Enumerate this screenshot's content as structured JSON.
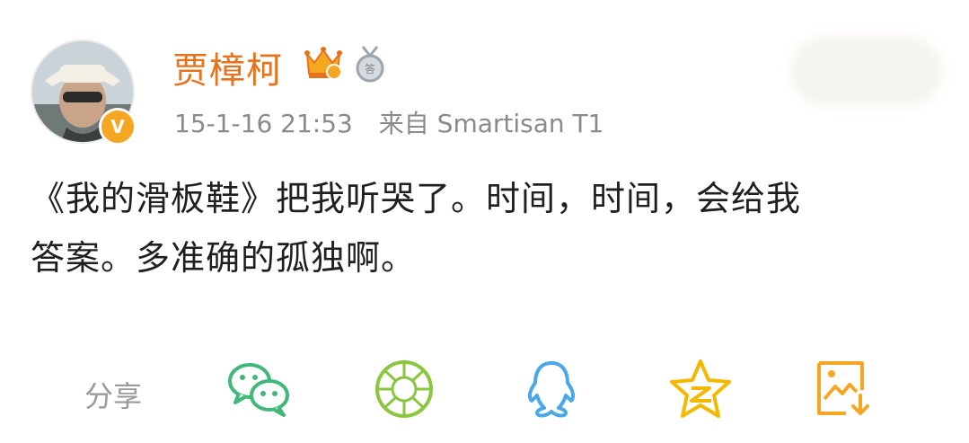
{
  "post": {
    "username": "贾樟柯",
    "timestamp": "15-1-16 21:53",
    "source": "来自 Smartisan T1",
    "content_line1": "《我的滑板鞋》把我听哭了。时间，时间，会给我",
    "content_line2": "答案。多准确的孤独啊。",
    "verified_mark": "V"
  },
  "share": {
    "label": "分享",
    "icons": [
      "wechat-icon",
      "moments-icon",
      "qq-icon",
      "qzone-icon",
      "save-image-icon"
    ]
  },
  "colors": {
    "username": "#e8721c",
    "meta": "#8a8a8a",
    "text": "#1f1f1f",
    "wechat": "#3fb87a",
    "moments": "#8cc63f",
    "qq": "#4aa8e8",
    "qzone": "#f5b800",
    "save": "#f5a623"
  }
}
